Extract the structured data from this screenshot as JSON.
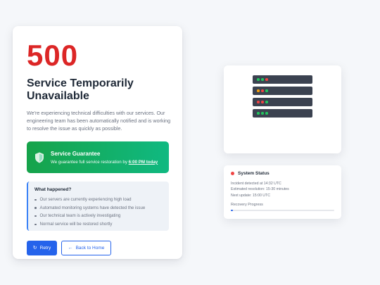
{
  "error": {
    "code": "500",
    "title": "Service Temporarily Unavailable",
    "description": "We're experiencing technical difficulties with our services. Our engineering team has been automatically notified and is working to resolve the issue as quickly as possible."
  },
  "guarantee": {
    "icon": "shield-icon",
    "title": "Service Guarantee",
    "text_prefix": "We guarantee full service restoration by ",
    "time": "6:00 PM today"
  },
  "info": {
    "title": "What happened?",
    "items": [
      "Our servers are currently experiencing high load",
      "Automated monitoring systems have detected the issue",
      "Our technical team is actively investigating",
      "Normal service will be restored shortly"
    ]
  },
  "buttons": {
    "retry": {
      "label": "Retry",
      "icon": "↻"
    },
    "home": {
      "label": "Back to Home",
      "icon": "←"
    }
  },
  "servers": [
    {
      "leds": [
        "#22c55e",
        "#22c55e",
        "#ef4444"
      ]
    },
    {
      "leds": [
        "#f59e0b",
        "#ef4444",
        "#22c55e"
      ]
    },
    {
      "leds": [
        "#ef4444",
        "#ef4444",
        "#22c55e"
      ]
    },
    {
      "leds": [
        "#22c55e",
        "#22c55e",
        "#22c55e"
      ]
    }
  ],
  "status": {
    "title": "System Status",
    "lines": [
      "Incident detected at 14:32 UTC",
      "Estimated resolution: 15-30 minutes",
      "Next update: 15:00 UTC"
    ],
    "progress_label": "Recovery Progress",
    "progress_fraction": 0.02
  },
  "colors": {
    "accent": "#2563eb",
    "error": "#dc2626",
    "success": "#10b981",
    "status_down": "#ef4444"
  }
}
